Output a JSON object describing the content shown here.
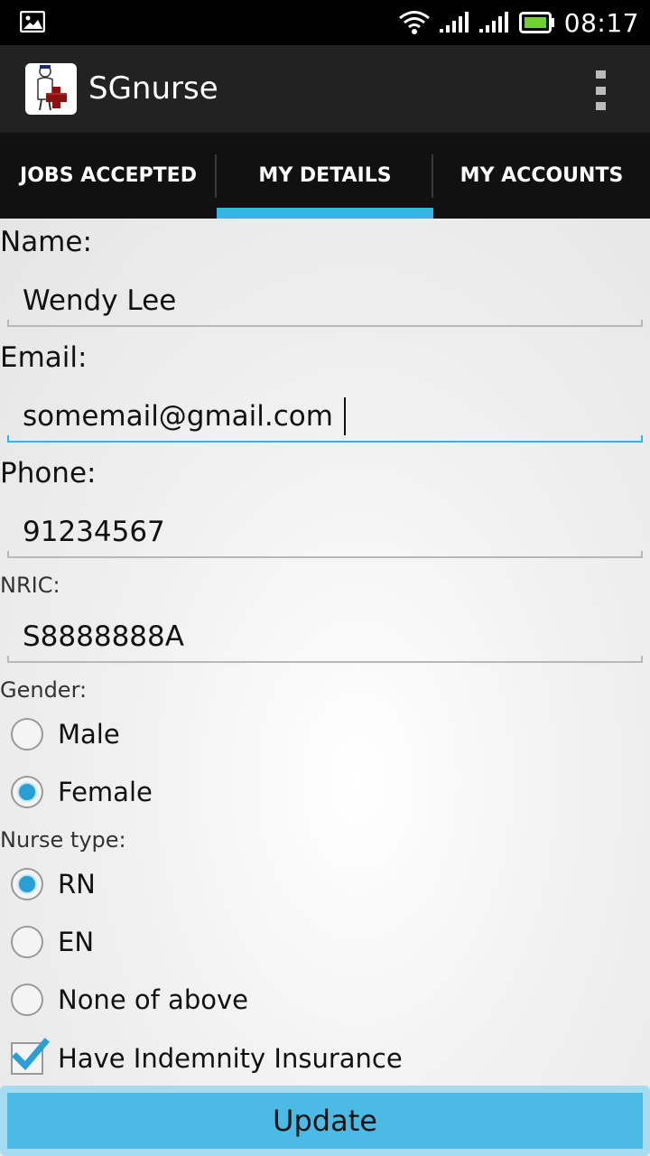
{
  "status_bar": {
    "time": "08:17",
    "icons": [
      "gallery-icon",
      "wifi-icon",
      "signal-icon",
      "signal-icon",
      "battery-icon"
    ]
  },
  "action_bar": {
    "title": "SGnurse",
    "app_icon": "nurse-logo-icon",
    "overflow_icon": "overflow-menu-icon"
  },
  "tabs": [
    {
      "label": "JOBS ACCEPTED",
      "active": false
    },
    {
      "label": "MY DETAILS",
      "active": true
    },
    {
      "label": "MY ACCOUNTS",
      "active": false
    }
  ],
  "form": {
    "name_label": "Name:",
    "name_value": "Wendy Lee",
    "email_label": "Email:",
    "email_value": "somemail@gmail.com",
    "phone_label": "Phone:",
    "phone_value": "91234567",
    "nric_label": "NRIC:",
    "nric_value": "S8888888A",
    "gender_label": "Gender:",
    "gender_options": [
      {
        "label": "Male",
        "checked": false
      },
      {
        "label": "Female",
        "checked": true
      }
    ],
    "nurse_type_label": "Nurse type:",
    "nurse_type_options": [
      {
        "label": "RN",
        "checked": true
      },
      {
        "label": "EN",
        "checked": false
      },
      {
        "label": "None of above",
        "checked": false
      }
    ],
    "insurance_label": "Have Indemnity Insurance",
    "insurance_checked": true,
    "update_label": "Update"
  },
  "colors": {
    "accent": "#33b5e5",
    "action_bar": "#222222",
    "tab_bar": "#111111",
    "button": "#4bbbe6"
  }
}
